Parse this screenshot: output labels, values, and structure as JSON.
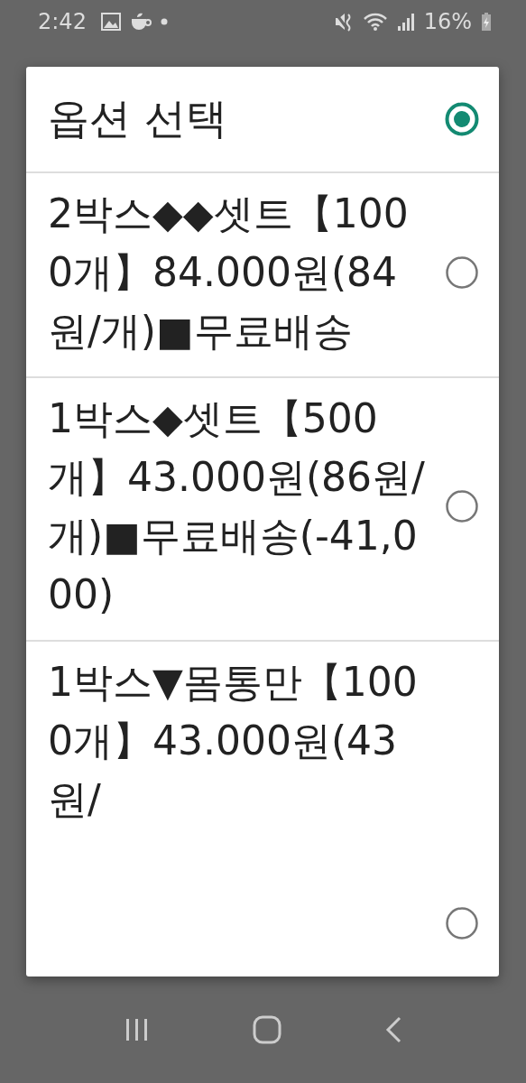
{
  "status_bar": {
    "time": "2:42",
    "battery": "16%"
  },
  "dialog": {
    "title": "옵션 선택",
    "title_selected": true,
    "options": [
      {
        "label": "2박스◆◆셋트【1000개】84.000원(84원/개)■무료배송",
        "selected": false
      },
      {
        "label": "1박스◆셋트【500개】43.000원(86원/개)■무료배송(-41,000)",
        "selected": false
      },
      {
        "label": "1박스▼몸통만【1000개】43.000원(43원/",
        "selected": false
      }
    ]
  }
}
